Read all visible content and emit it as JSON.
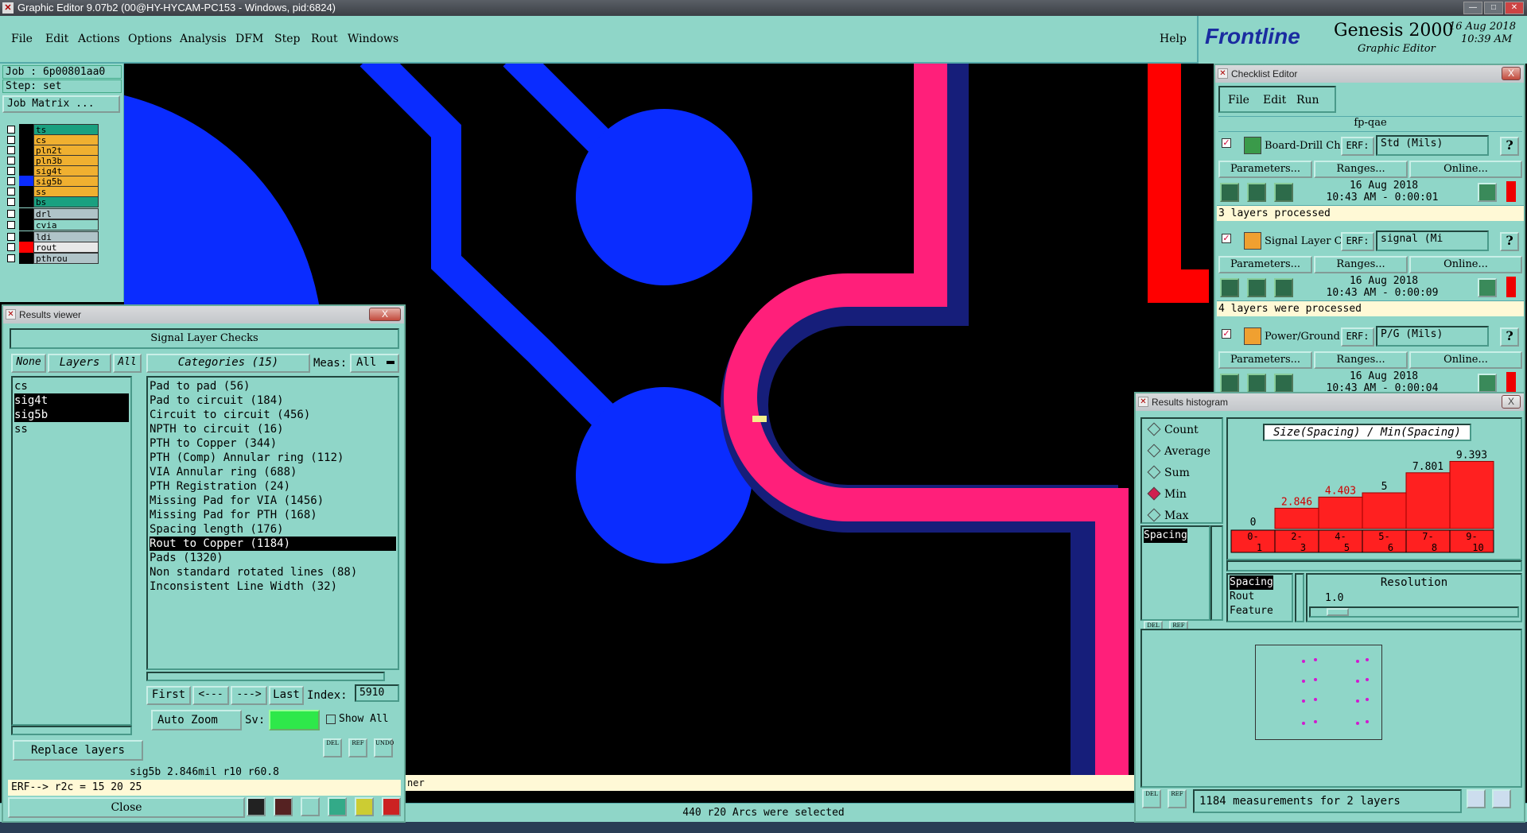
{
  "titlebar": {
    "title": "Graphic Editor 9.07b2 (00@HY-HYCAM-PC153 - Windows, pid:6824)"
  },
  "menu": [
    "File",
    "Edit",
    "Actions",
    "Options",
    "Analysis",
    "DFM",
    "Step",
    "Rout",
    "Windows"
  ],
  "help": "Help",
  "brand": {
    "logo": "Frontline",
    "product": "Genesis 2000",
    "subtitle": "Graphic Editor",
    "date": "16 Aug 2018",
    "time": "10:39 AM"
  },
  "left": {
    "job": "Job : 6p00801aa0",
    "step": "Step: set",
    "job_matrix": "Job Matrix ...",
    "layers": [
      {
        "name": "ts",
        "color": "#1aa080"
      },
      {
        "name": "cs",
        "color": "#f0b030"
      },
      {
        "name": "pln2t",
        "color": "#f0b030"
      },
      {
        "name": "pln3b",
        "color": "#f0b030"
      },
      {
        "name": "sig4t",
        "color": "#f0b030"
      },
      {
        "name": "sig5b",
        "color": "#f0b030"
      },
      {
        "name": "ss",
        "color": "#f0b030"
      },
      {
        "name": "bs",
        "color": "#1aa080"
      },
      {
        "name": "drl",
        "color": "#b0c4c8"
      },
      {
        "name": "cvia",
        "color": "#8fd6c8"
      },
      {
        "name": "ldi",
        "color": "#b0c4c8"
      },
      {
        "name": "rout",
        "color": "#e8e8e8"
      },
      {
        "name": "pthrou",
        "color": "#b0c4c8"
      }
    ]
  },
  "results_viewer": {
    "title": "Results viewer",
    "close_x": "X",
    "header": "Signal Layer Checks",
    "none": "None",
    "layers_btn": "Layers",
    "all": "All",
    "categories_btn": "Categories (15)",
    "meas_label": "Meas:",
    "meas_value": "All",
    "layer_list": [
      "cs",
      "sig4t",
      "sig5b",
      "ss"
    ],
    "categories": [
      "Pad to pad (56)",
      "Pad to circuit (184)",
      "Circuit to circuit (456)",
      "NPTH to circuit (16)",
      "PTH to Copper (344)",
      "PTH (Comp) Annular ring (112)",
      "VIA Annular ring (688)",
      "PTH Registration (24)",
      "Missing Pad for VIA (1456)",
      "Missing Pad for PTH (168)",
      "Spacing length (176)",
      "Rout to Copper (1184)",
      "Pads (1320)",
      "Non standard rotated lines (88)",
      "Inconsistent Line Width (32)"
    ],
    "first": "First",
    "prev": "<---",
    "next": "--->",
    "last": "Last",
    "index_label": "Index:",
    "index_value": "5910",
    "auto_zoom": "Auto Zoom",
    "sv_label": "Sv:",
    "show_all": "Show All",
    "replace_layers": "Replace layers",
    "status": "sig5b 2.846mil  r10  r60.8",
    "erf": "ERF--> r2c = 15 20 25",
    "close_btn": "Close",
    "icons": {
      "del": "DEL",
      "ref": "REF",
      "undo": "UNDO"
    }
  },
  "checklist": {
    "title": "Checklist Editor",
    "close_x": "X",
    "menu": [
      "File",
      "Edit",
      "Run"
    ],
    "name": "fp-qae",
    "erf_label": "ERF:",
    "params": "Parameters...",
    "ranges": "Ranges...",
    "online": "Online...",
    "items": [
      {
        "name": "Board-Drill Che",
        "erf": "Std (Mils)",
        "date": "16 Aug 2018",
        "time": "10:43 AM - 0:00:01",
        "status": "3 layers processed",
        "q": "?"
      },
      {
        "name": "Signal Layer Ch",
        "erf": "signal (Mi",
        "date": "16 Aug 2018",
        "time": "10:43 AM - 0:00:09",
        "status": "4 layers were processed",
        "q": "?"
      },
      {
        "name": "Power/Ground C",
        "erf": "P/G (Mils)",
        "date": "16 Aug 2018",
        "time": "10:43 AM - 0:00:04",
        "status": "",
        "q": "?"
      }
    ]
  },
  "histogram": {
    "title": "Results histogram",
    "close_x": "X",
    "radios": [
      "Count",
      "Average",
      "Sum",
      "Min",
      "Max"
    ],
    "selected": "Min",
    "chart_title": "Size(Spacing) / Min(Spacing)",
    "meas_list": [
      "Spacing"
    ],
    "attr_list": [
      "Spacing",
      "Rout",
      "Feature"
    ],
    "resolution_label": "Resolution",
    "resolution_value": "1.0",
    "status": "1184 measurements for 2 layers",
    "icons": {
      "del": "DEL",
      "ref": "REF"
    }
  },
  "chart_data": {
    "type": "bar",
    "title": "Size(Spacing) / Min(Spacing)",
    "categories": [
      "0-1",
      "2-3",
      "4-5",
      "5-6",
      "7-8",
      "9-10"
    ],
    "values": [
      0,
      2.846,
      4.403,
      5,
      7.801,
      9.393
    ],
    "labels": [
      "0",
      "2.846",
      "4.403",
      "5",
      "7.801",
      "9.393"
    ],
    "label_colors": [
      "#000000",
      "#d00000",
      "#d00000",
      "#000000",
      "#000000",
      "#000000"
    ],
    "bar_color": "#ff2020",
    "ylim": [
      0,
      10
    ]
  },
  "canvas_text": "ner",
  "statusbar": "440 r20 Arcs were selected",
  "colors": {
    "panel": "#8fd6c8",
    "pad_blue": "#0a2cff",
    "trace_pink": "#ff1f7a",
    "trace_navy": "#161e7a",
    "rout_red": "#ff0000"
  }
}
